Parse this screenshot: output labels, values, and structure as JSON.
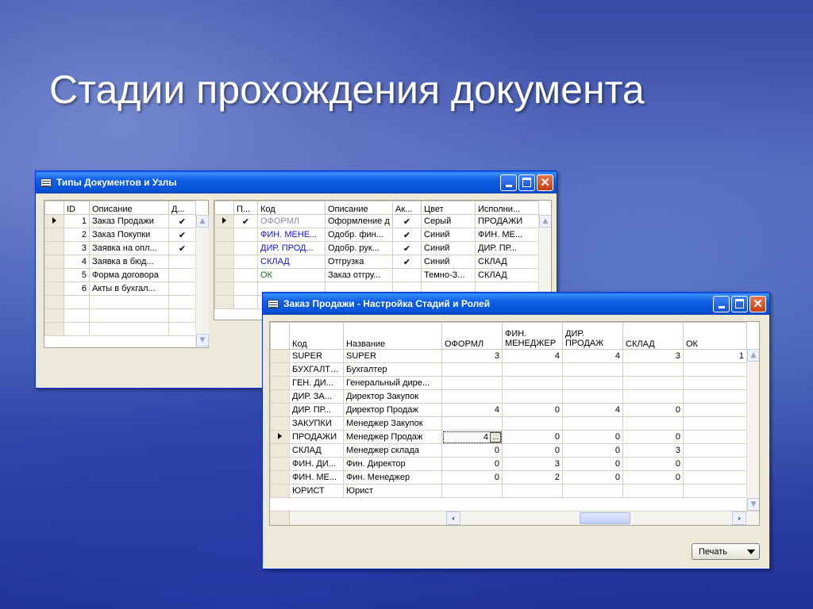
{
  "slide": {
    "title": "Стадии прохождения документа"
  },
  "window1": {
    "title": "Типы Документов и Узлы",
    "left_table": {
      "headers": [
        "ID",
        "Описание",
        "Д..."
      ],
      "rows": [
        {
          "id": "1",
          "desc": "Заказ Продажи",
          "check": "✔"
        },
        {
          "id": "2",
          "desc": "Заказ Покупки",
          "check": "✔"
        },
        {
          "id": "3",
          "desc": "Заявка на опл...",
          "check": "✔"
        },
        {
          "id": "4",
          "desc": "Заявка в бюд...",
          "check": ""
        },
        {
          "id": "5",
          "desc": "Форма договора",
          "check": ""
        },
        {
          "id": "6",
          "desc": "Акты в бухгал...",
          "check": ""
        }
      ]
    },
    "right_table": {
      "headers": [
        "П...",
        "Код",
        "Описание",
        "Ак...",
        "Цвет",
        "Исполни..."
      ],
      "rows": [
        {
          "p": "✔",
          "code": "ОФОРМЛ",
          "desc": "Оформление д",
          "active": "✔",
          "color": "Серый",
          "exec": "ПРОДАЖИ",
          "code_color": "#8a8aa8"
        },
        {
          "p": "",
          "code": "ФИН. МЕНЕ...",
          "desc": "Одобр. фин...",
          "active": "✔",
          "color": "Синий",
          "exec": "ФИН. МЕ...",
          "code_color": "#1010d0"
        },
        {
          "p": "",
          "code": "ДИР. ПРОД...",
          "desc": "Одобр. рук...",
          "active": "✔",
          "color": "Синий",
          "exec": "ДИР. ПР...",
          "code_color": "#1010d0"
        },
        {
          "p": "",
          "code": "СКЛАД",
          "desc": "Отгрузка",
          "active": "✔",
          "color": "Синий",
          "exec": "СКЛАД",
          "code_color": "#1010d0"
        },
        {
          "p": "",
          "code": "ОК",
          "desc": "Заказ отгру...",
          "active": "",
          "color": "Темно-З...",
          "exec": "СКЛАД",
          "code_color": "#0a7a0a"
        }
      ]
    }
  },
  "window2": {
    "title": "Заказ Продажи - Настройка Стадий и Ролей",
    "headers": [
      "Код",
      "Название",
      "ОФОРМЛ",
      "ФИН. МЕНЕДЖЕР",
      "ДИР. ПРОДАЖ",
      "СКЛАД",
      "ОК"
    ],
    "rows": [
      {
        "code": "SUPER",
        "name": "SUPER",
        "v1": "3",
        "v2": "4",
        "v3": "4",
        "v4": "3",
        "v5": "1"
      },
      {
        "code": "БУХГАЛТЕР",
        "name": "Бухгалтер",
        "v1": "",
        "v2": "",
        "v3": "",
        "v4": "",
        "v5": ""
      },
      {
        "code": "ГЕН. ДИ...",
        "name": "Генеральный дире...",
        "v1": "",
        "v2": "",
        "v3": "",
        "v4": "",
        "v5": ""
      },
      {
        "code": "ДИР. ЗА...",
        "name": "Директор Закупок",
        "v1": "",
        "v2": "",
        "v3": "",
        "v4": "",
        "v5": ""
      },
      {
        "code": "ДИР. ПР...",
        "name": "Директор Продаж",
        "v1": "4",
        "v2": "0",
        "v3": "4",
        "v4": "0",
        "v5": ""
      },
      {
        "code": "ЗАКУПКИ",
        "name": "Менеджер Закупок",
        "v1": "",
        "v2": "",
        "v3": "",
        "v4": "",
        "v5": ""
      },
      {
        "code": "ПРОДАЖИ",
        "name": "Менеджер Продаж",
        "v1": "4",
        "v2": "0",
        "v3": "0",
        "v4": "0",
        "v5": ""
      },
      {
        "code": "СКЛАД",
        "name": "Менеджер склада",
        "v1": "0",
        "v2": "0",
        "v3": "0",
        "v4": "3",
        "v5": ""
      },
      {
        "code": "ФИН. ДИ...",
        "name": "Фин. Директор",
        "v1": "0",
        "v2": "3",
        "v3": "0",
        "v4": "0",
        "v5": ""
      },
      {
        "code": "ФИН. МЕ...",
        "name": "Фин. Менеджер",
        "v1": "0",
        "v2": "2",
        "v3": "0",
        "v4": "0",
        "v5": ""
      },
      {
        "code": "ЮРИСТ",
        "name": "Юрист",
        "v1": "",
        "v2": "",
        "v3": "",
        "v4": "",
        "v5": ""
      }
    ],
    "ellipsis_label": "...",
    "print_label": "Печать"
  }
}
